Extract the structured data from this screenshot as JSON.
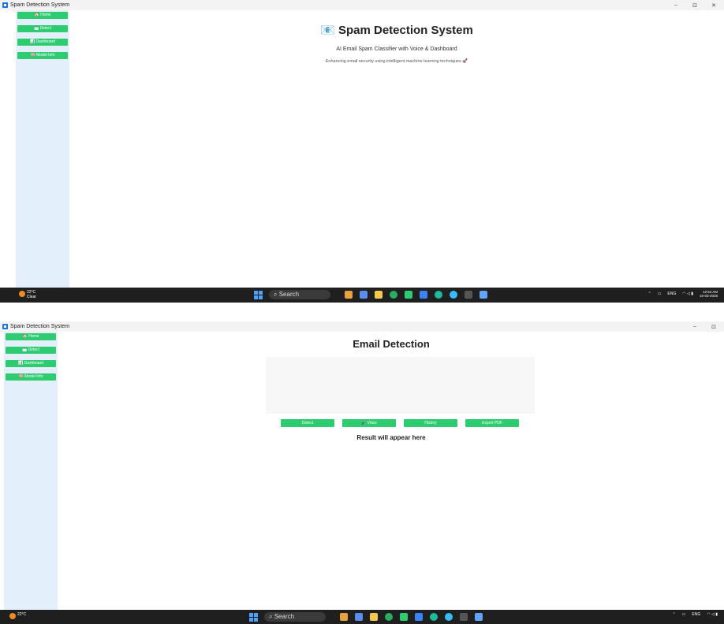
{
  "window": {
    "title": "Spam Detection System"
  },
  "window_controls": {
    "minimize": "–",
    "maximize": "⊡",
    "close": "✕"
  },
  "sidebar": {
    "items": [
      {
        "label": "🏠 Home"
      },
      {
        "label": "📩 Detect"
      },
      {
        "label": "📊 Dashboard"
      },
      {
        "label": "🧠 Model Info"
      }
    ]
  },
  "home": {
    "title": "📧 Spam Detection System",
    "subtitle": "AI Email Spam Classifier with Voice & Dashboard",
    "tagline": "Enhancing email security using intelligent machine learning techniques 🚀"
  },
  "detect": {
    "title": "Email Detection",
    "email_value": "",
    "buttons": {
      "detect": "Detect",
      "voice": "🎤 Voice",
      "history": "History",
      "export": "Export PDF"
    },
    "result": "Result will appear here"
  },
  "taskbar": {
    "weather_temp": "22°C",
    "weather_desc": "Clear",
    "search": "Search",
    "lang": "ENG",
    "lang_sub": "IN",
    "time": "12:54 AM",
    "date": "10-03-2026"
  },
  "colors": {
    "accent": "#2ecc71",
    "sidebar": "#e3f0fb",
    "taskbar": "#1f1f1f"
  }
}
